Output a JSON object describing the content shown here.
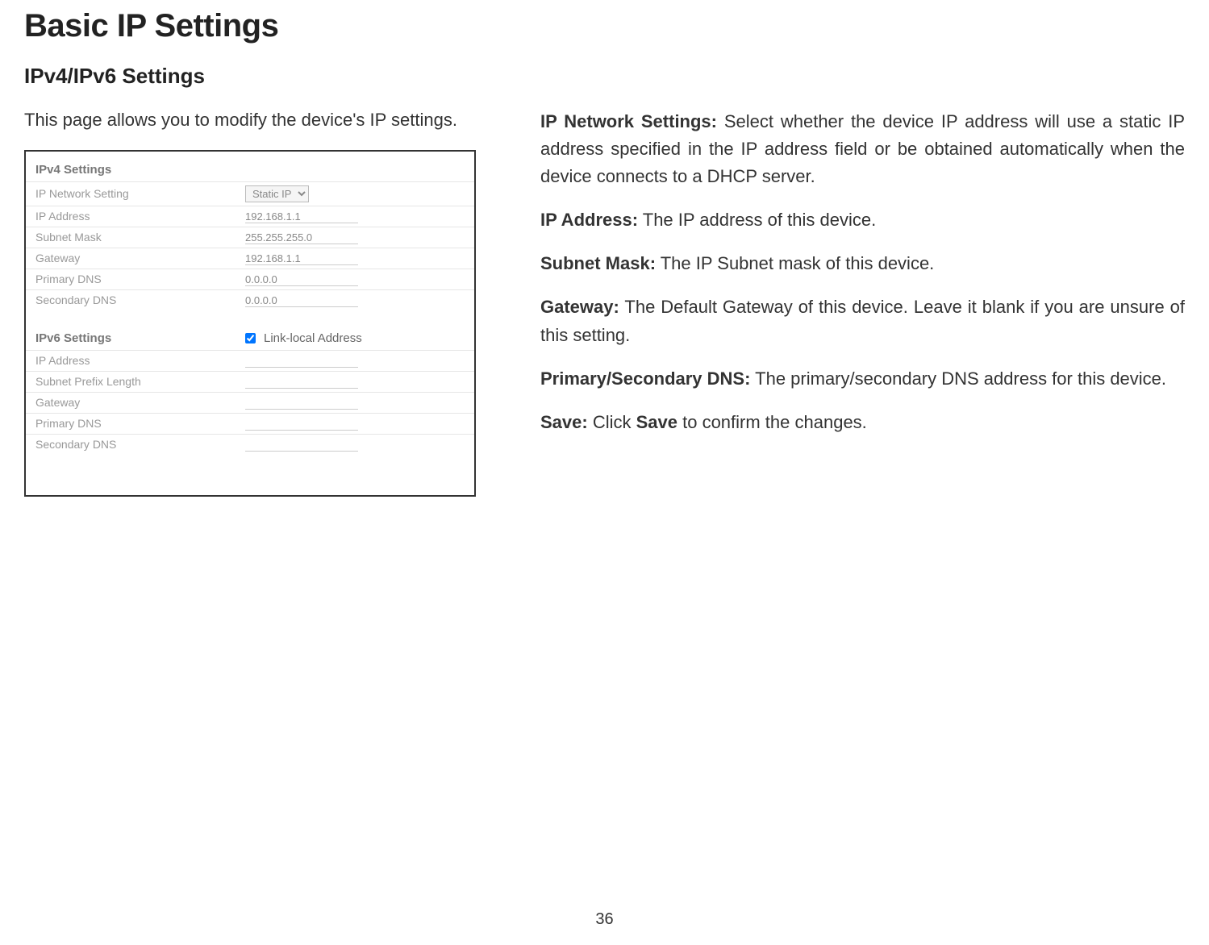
{
  "page": {
    "h1": "Basic IP Settings",
    "h2": "IPv4/IPv6 Settings",
    "intro": "This page allows you to modify the device's IP settings.",
    "page_number": "36"
  },
  "screenshot": {
    "ipv4": {
      "heading": "IPv4 Settings",
      "rows": {
        "net_setting": {
          "label": "IP Network Setting",
          "value": "Static IP"
        },
        "ip_address": {
          "label": "IP Address",
          "value": "192.168.1.1"
        },
        "subnet": {
          "label": "Subnet Mask",
          "value": "255.255.255.0"
        },
        "gateway": {
          "label": "Gateway",
          "value": "192.168.1.1"
        },
        "pdns": {
          "label": "Primary DNS",
          "value": "0.0.0.0"
        },
        "sdns": {
          "label": "Secondary DNS",
          "value": "0.0.0.0"
        }
      }
    },
    "ipv6": {
      "heading": "IPv6 Settings",
      "checkbox_label": "Link-local Address",
      "rows": {
        "ip_address": {
          "label": "IP Address",
          "value": ""
        },
        "prefix": {
          "label": "Subnet Prefix Length",
          "value": ""
        },
        "gateway": {
          "label": "Gateway",
          "value": ""
        },
        "pdns": {
          "label": "Primary DNS",
          "value": ""
        },
        "sdns": {
          "label": "Secondary DNS",
          "value": ""
        }
      }
    }
  },
  "descriptions": {
    "ipnet": {
      "label": "IP Network Settings:",
      "text": " Select whether the device IP address will use a static IP address specified in the IP address field or be obtained automatically when the device connects to a DHCP server."
    },
    "ipaddr": {
      "label": "IP Address:",
      "text": " The IP address of this device."
    },
    "subnet": {
      "label": "Subnet Mask:",
      "text": " The IP Subnet mask of this device."
    },
    "gateway": {
      "label": "Gateway:",
      "text": " The Default Gateway of this device. Leave it blank if you are unsure of this setting."
    },
    "dns": {
      "label": "Primary/Secondary DNS:",
      "text": " The primary/secondary DNS address for this device."
    },
    "save": {
      "label": "Save:",
      "text_a": " Click ",
      "label_b": "Save",
      "text_b": " to confirm the changes."
    }
  }
}
